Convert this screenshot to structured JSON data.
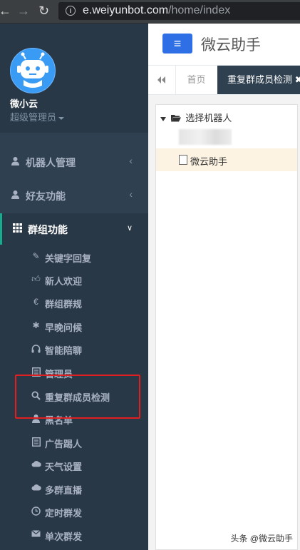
{
  "browser": {
    "url_host": "e.weiyunbot.com",
    "url_path": "/home/index"
  },
  "profile": {
    "name": "微小云",
    "role": "超级管理员"
  },
  "sidebar": {
    "items": [
      {
        "label": "机器人管理",
        "icon": "user-icon"
      },
      {
        "label": "好友功能",
        "icon": "user-icon"
      },
      {
        "label": "群组功能",
        "icon": "grid-icon"
      }
    ],
    "sub_items": [
      {
        "label": "关键字回复",
        "icon": "pencil-icon"
      },
      {
        "label": "新人欢迎",
        "icon": "thumbs-up-icon"
      },
      {
        "label": "群组群规",
        "icon": "euro-icon"
      },
      {
        "label": "早晚问候",
        "icon": "asterisk-icon"
      },
      {
        "label": "智能陪聊",
        "icon": "headphones-icon"
      },
      {
        "label": "管理员",
        "icon": "list-icon"
      },
      {
        "label": "重复群成员检测",
        "icon": "search-icon"
      },
      {
        "label": "黑名单",
        "icon": "user-icon"
      },
      {
        "label": "广告踢人",
        "icon": "list-icon"
      },
      {
        "label": "天气设置",
        "icon": "cloud-icon"
      },
      {
        "label": "多群直播",
        "icon": "cloud-icon"
      },
      {
        "label": "定时群发",
        "icon": "clock-icon"
      },
      {
        "label": "单次群发",
        "icon": "envelope-icon"
      }
    ]
  },
  "header": {
    "menu_icon": "≡",
    "brand": "微云助手"
  },
  "tabs": {
    "home": "首页",
    "active": "重复群成员检测"
  },
  "tree": {
    "root": "选择机器人",
    "child": "微云助手"
  },
  "watermark": "头条 @微云助手",
  "colors": {
    "sidebar": "#2f4050",
    "accent": "#19aa8d",
    "menu_button": "#2f6fe6",
    "highlight": "#e02020"
  }
}
